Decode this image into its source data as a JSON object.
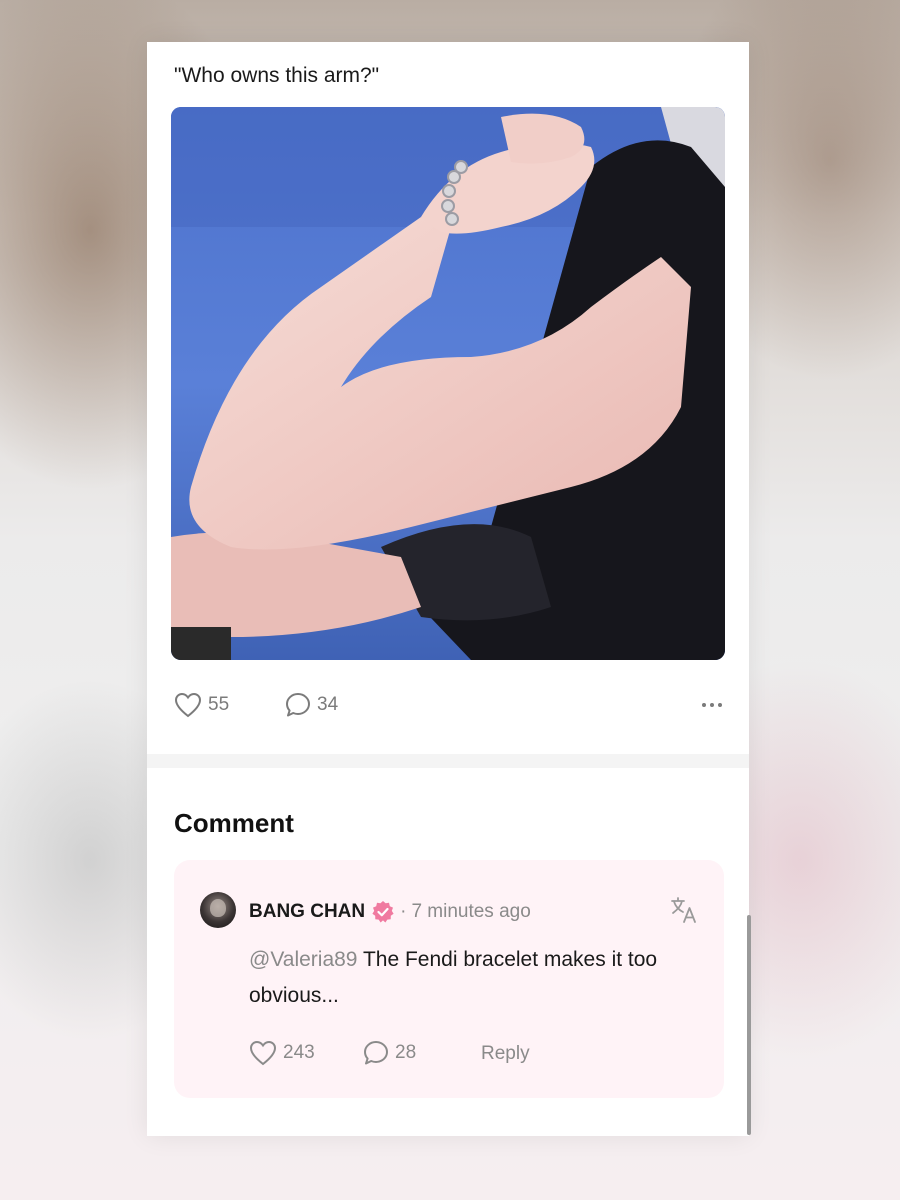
{
  "post": {
    "text": "\"Who owns this arm?\"",
    "likes": "55",
    "comments": "34"
  },
  "comment_section": {
    "title": "Comment",
    "comment": {
      "author": "BANG CHAN",
      "separator": "·",
      "time": "7 minutes ago",
      "mention": "@Valeria89",
      "text": " The Fendi bracelet makes it too obvious...",
      "likes": "243",
      "replies": "28",
      "reply_label": "Reply"
    }
  },
  "colors": {
    "verified_badge": "#f07aa0",
    "comment_background": "#fff3f7",
    "icon_gray": "#7b7b7b"
  }
}
